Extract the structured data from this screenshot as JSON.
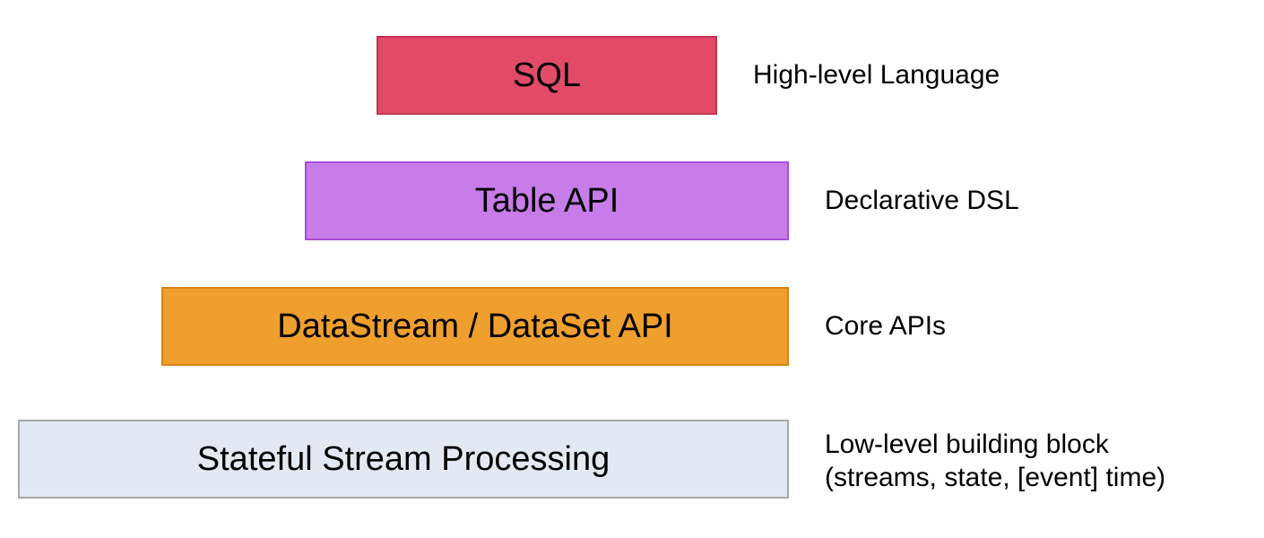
{
  "layers": {
    "sql": {
      "title": "SQL",
      "description": "High-level Language",
      "color": "#e14b68",
      "border": "#c23550"
    },
    "table": {
      "title": "Table API",
      "description": "Declarative DSL",
      "color": "#c77ce8",
      "border": "#a94bd4"
    },
    "datastream": {
      "title": "DataStream / DataSet API",
      "description": "Core APIs",
      "color": "#ef9f2d",
      "border": "#d98416"
    },
    "stateful": {
      "title": "Stateful Stream Processing",
      "description": "Low-level building block\n(streams, state, [event] time)",
      "description_line1": "Low-level building block",
      "description_line2": "(streams, state, [event] time)",
      "color": "#e3e9f2",
      "border": "#a8a8a8"
    }
  }
}
